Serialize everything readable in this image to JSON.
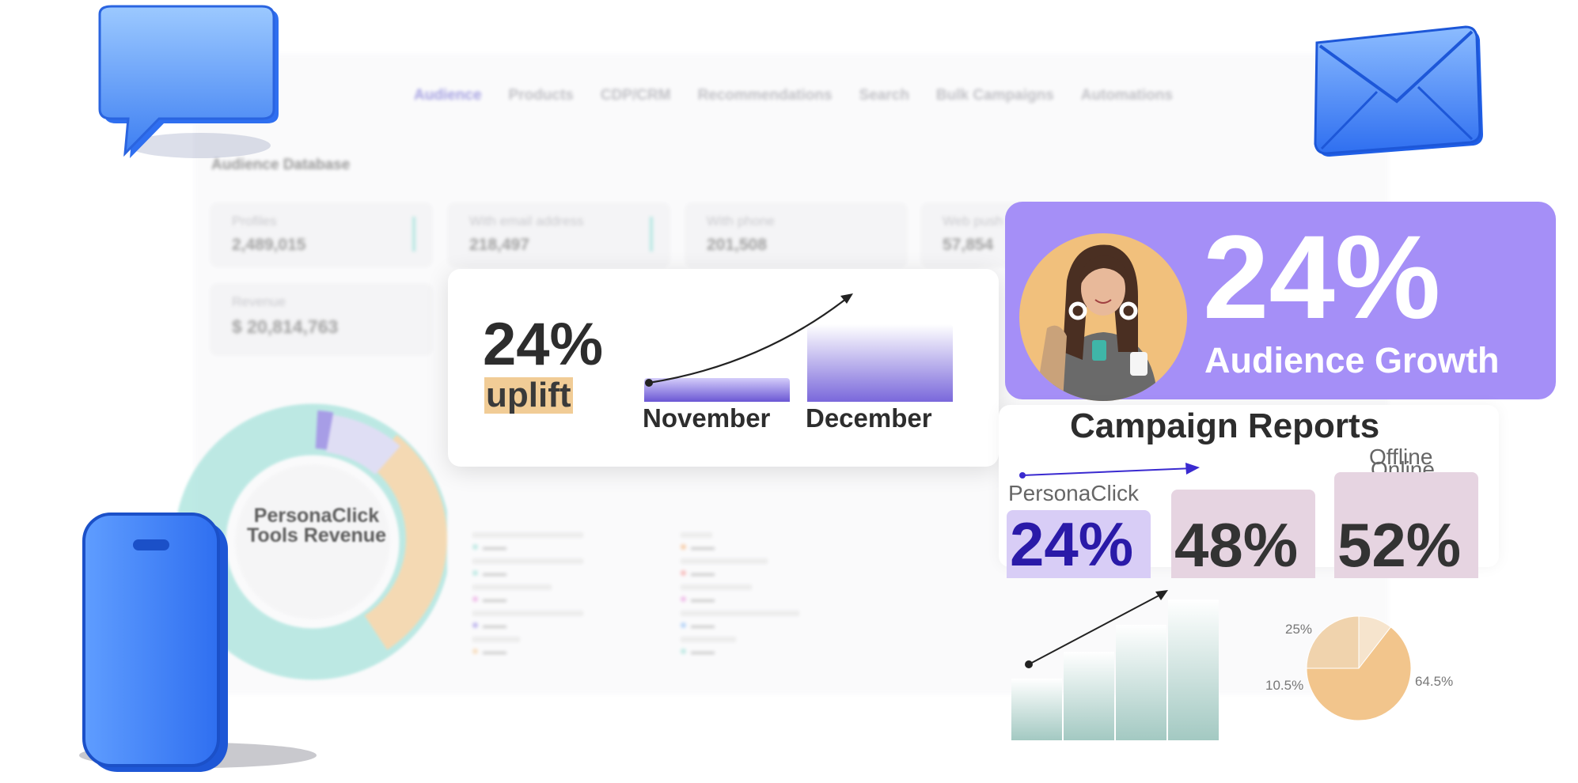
{
  "nav": {
    "items": [
      "Audience",
      "Products",
      "CDP/CRM",
      "Recommendations",
      "Search",
      "Bulk Campaigns",
      "Automations"
    ]
  },
  "dashboard": {
    "title": "Audience Database",
    "kpis": [
      {
        "label": "Profiles",
        "value": "2,489,015"
      },
      {
        "label": "With email address",
        "value": "218,497"
      },
      {
        "label": "With phone",
        "value": "201,508"
      },
      {
        "label": "Web push",
        "value": "57,854"
      }
    ],
    "revenue": {
      "label": "Revenue",
      "value": "$ 20,814,763"
    },
    "donut_label": "PersonaClick Tools Revenue"
  },
  "uplift": {
    "percent": "24%",
    "word": "uplift",
    "months": [
      "November",
      "December"
    ],
    "bar_levels": [
      0.24,
      1.0
    ]
  },
  "growth": {
    "percent": "24%",
    "label": "Audience Growth"
  },
  "campaign": {
    "title": "Campaign Reports",
    "channels": [
      {
        "name": "PersonaClick",
        "value": "24%",
        "color": "#2a1aa8",
        "bg": "#d8cdf6"
      },
      {
        "name": "Online",
        "value": "48%",
        "color": "#333333",
        "bg": "#e6d4e1"
      },
      {
        "name": "Offline",
        "value": "52%",
        "color": "#333333",
        "bg": "#e6d4e1"
      }
    ]
  },
  "chart_data": [
    {
      "type": "pie",
      "labels": [
        "25%",
        "10.5%",
        "64.5%"
      ],
      "values": [
        25,
        10.5,
        64.5
      ]
    }
  ],
  "colors": {
    "accent": "#a58ff7",
    "teal": "#a8e3dc",
    "peach": "#f2cf9c",
    "icon_blue": "#2f6ff0"
  }
}
